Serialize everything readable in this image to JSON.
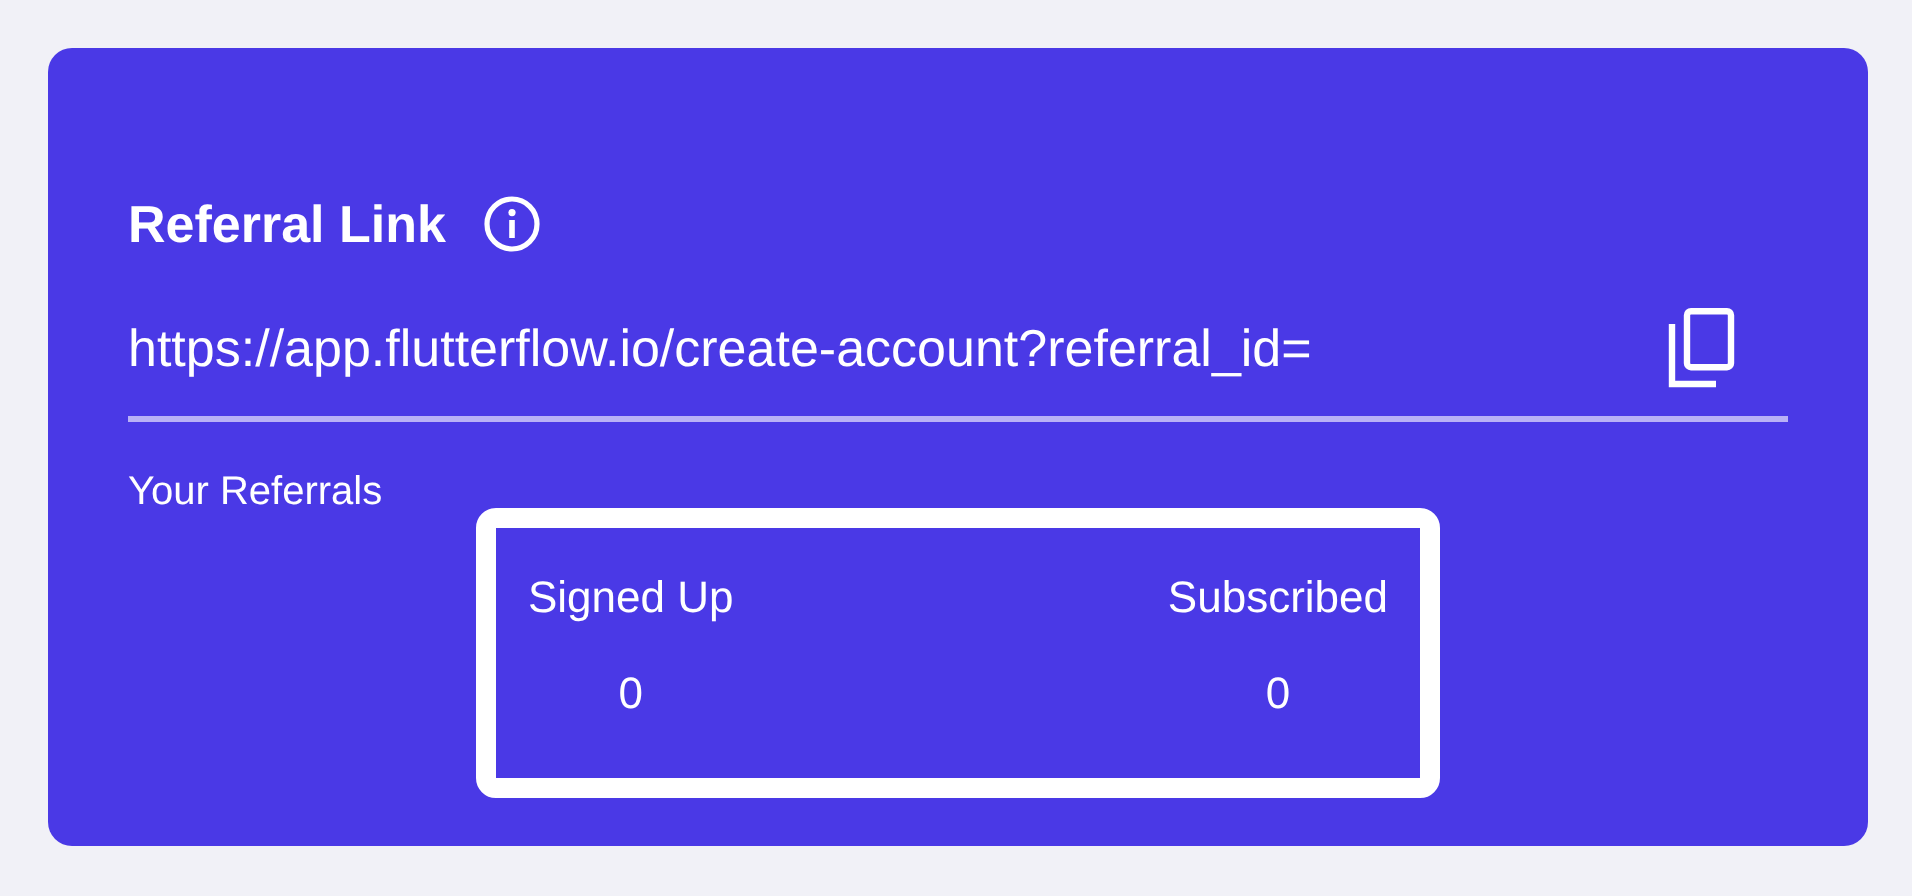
{
  "card": {
    "title": "Referral Link",
    "link": "https://app.flutterflow.io/create-account?referral_id=",
    "section_label": "Your Referrals",
    "stats": [
      {
        "label": "Signed Up",
        "value": "0"
      },
      {
        "label": "Subscribed",
        "value": "0"
      }
    ]
  }
}
